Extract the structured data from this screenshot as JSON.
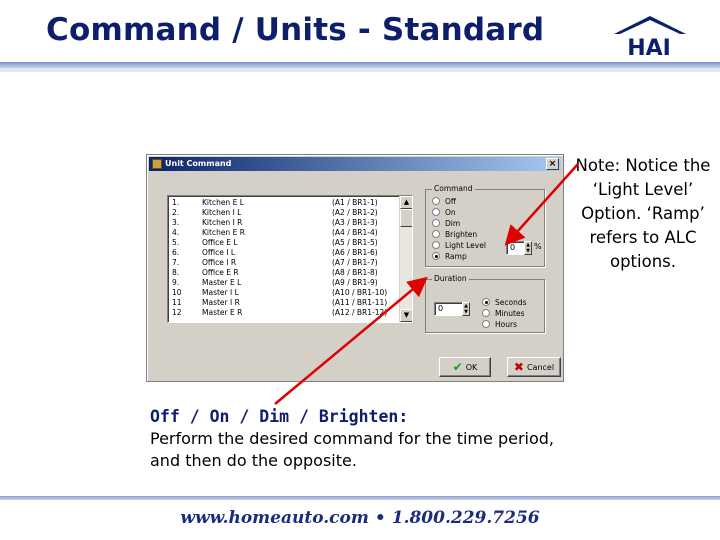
{
  "slide": {
    "title": "Command / Units - Standard",
    "logo_text": "HAI",
    "footer_site": "www.homeauto.com",
    "footer_sep": "•",
    "footer_phone": "1.800.229.7256"
  },
  "note": {
    "text": "Note: Notice the ‘Light Level’ Option. ‘Ramp’ refers to ALC options."
  },
  "caption": {
    "title": "Off / On / Dim / Brighten:",
    "body": "Perform the desired command for the time period, and then do the opposite."
  },
  "dialog": {
    "title": "Unit Command",
    "close_label": "×",
    "units": [
      {
        "num": "1.",
        "name": "Kitchen E L",
        "addr": "(A1 / BR1-1)"
      },
      {
        "num": "2.",
        "name": "Kitchen I L",
        "addr": "(A2 / BR1-2)"
      },
      {
        "num": "3.",
        "name": "Kitchen I R",
        "addr": "(A3 / BR1-3)"
      },
      {
        "num": "4.",
        "name": "Kitchen E R",
        "addr": "(A4 / BR1-4)"
      },
      {
        "num": "5.",
        "name": "Office E L",
        "addr": "(A5 / BR1-5)"
      },
      {
        "num": "6.",
        "name": "Office I L",
        "addr": "(A6 / BR1-6)"
      },
      {
        "num": "7.",
        "name": "Office I R",
        "addr": "(A7 / BR1-7)"
      },
      {
        "num": "8.",
        "name": "Office E R",
        "addr": "(A8 / BR1-8)"
      },
      {
        "num": "9.",
        "name": "Master E L",
        "addr": "(A9 / BR1-9)"
      },
      {
        "num": "10",
        "name": "Master I L",
        "addr": "(A10 / BR1-10)"
      },
      {
        "num": "11",
        "name": "Master I R",
        "addr": "(A11 / BR1-11)"
      },
      {
        "num": "12",
        "name": "Master E R",
        "addr": "(A12 / BR1-12)"
      }
    ],
    "command_group": {
      "label": "Command",
      "options": [
        "Off",
        "On",
        "Dim",
        "Brighten",
        "Light Level",
        "Ramp"
      ],
      "selected": "Ramp"
    },
    "level_value": "0",
    "level_unit": "%",
    "duration_group": {
      "label": "Duration",
      "value": "0",
      "options": [
        "Seconds",
        "Minutes",
        "Hours"
      ],
      "selected": "Seconds"
    },
    "ok_label": "OK",
    "cancel_label": "Cancel",
    "scroll_up": "▲",
    "scroll_down": "▼",
    "spin_up": "▲",
    "spin_down": "▼"
  },
  "colors": {
    "title": "#0d1f6b",
    "arrow": "#e00000",
    "titlebar": "#0a246a"
  }
}
